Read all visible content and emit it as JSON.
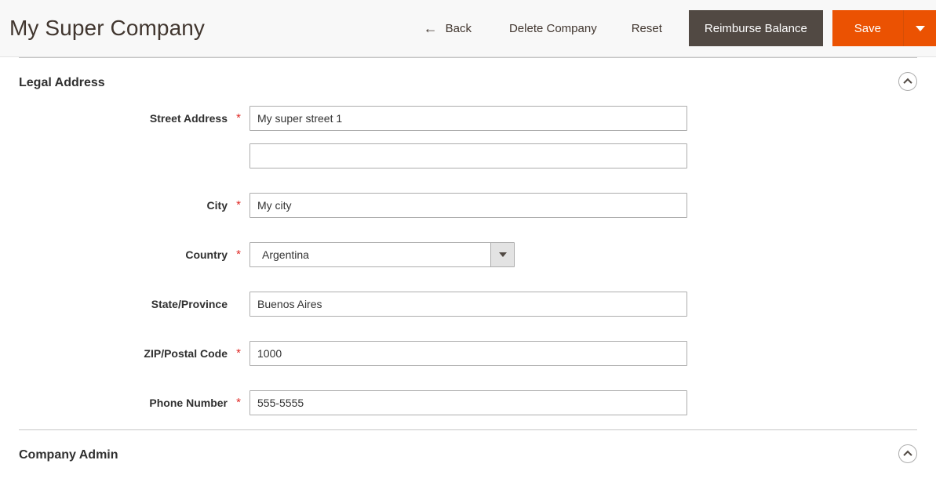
{
  "header": {
    "title": "My Super Company",
    "actions": {
      "back_label": "Back",
      "back_icon": "arrow-left-icon",
      "delete_label": "Delete Company",
      "reset_label": "Reset",
      "reimburse_label": "Reimburse Balance",
      "save_label": "Save",
      "save_toggle_icon": "caret-down-icon"
    },
    "colors": {
      "header_bg": "#f8f8f8",
      "title_color": "#41362f",
      "secondary_button_bg": "#514943",
      "primary_button_bg": "#eb5202",
      "required_mark": "#e02b27"
    }
  },
  "sections": {
    "legal_address": {
      "title": "Legal Address",
      "collapse_icon": "chevron-up-circle-icon",
      "fields": [
        {
          "label": "Street Address",
          "required": true,
          "value": "My super street 1",
          "type": "text"
        },
        {
          "label": "",
          "required": false,
          "value": "",
          "type": "text"
        },
        {
          "label": "City",
          "required": true,
          "value": "My city",
          "type": "text"
        },
        {
          "label": "Country",
          "required": true,
          "value": "Argentina",
          "type": "select"
        },
        {
          "label": "State/Province",
          "required": false,
          "value": "Buenos Aires",
          "type": "text"
        },
        {
          "label": "ZIP/Postal Code",
          "required": true,
          "value": "1000",
          "type": "text"
        },
        {
          "label": "Phone Number",
          "required": true,
          "value": "555-5555",
          "type": "text"
        }
      ]
    },
    "company_admin": {
      "title": "Company Admin",
      "collapse_icon": "chevron-up-circle-icon"
    }
  }
}
